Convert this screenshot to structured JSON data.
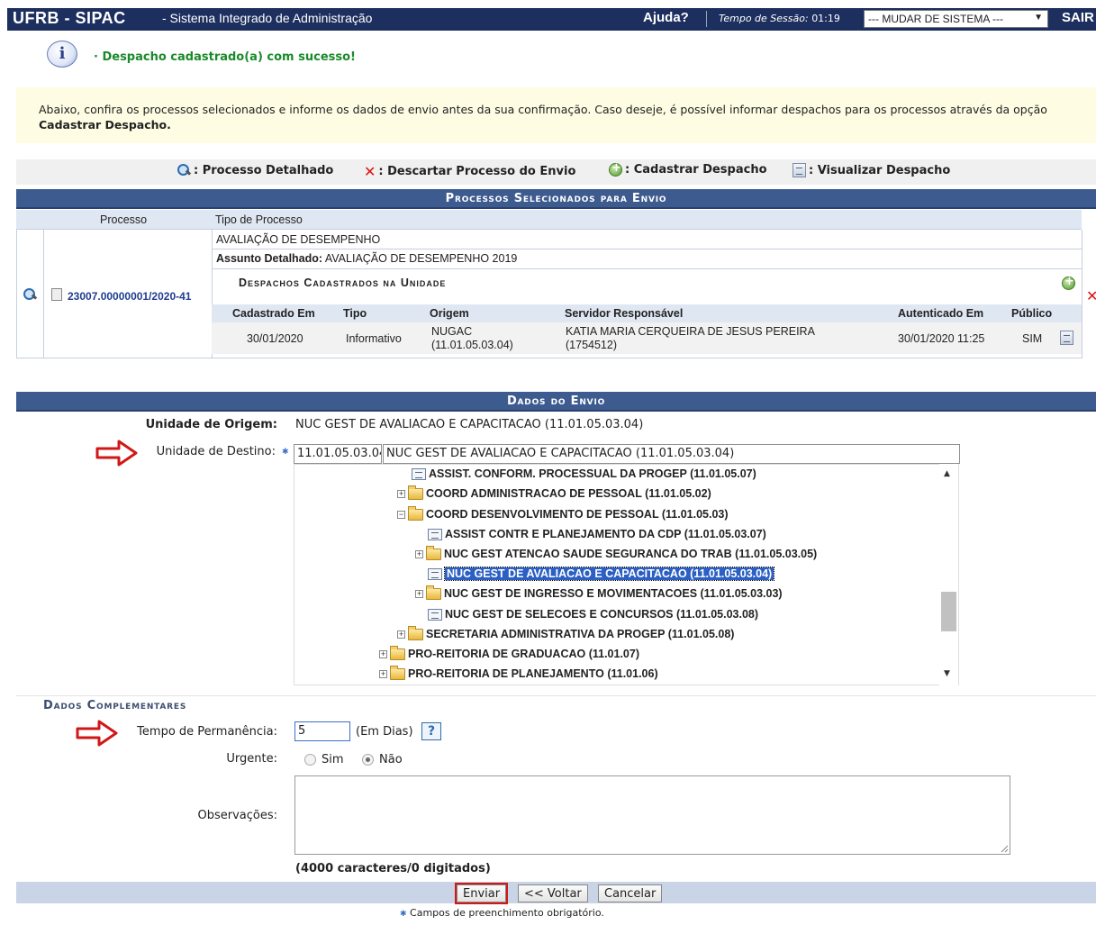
{
  "topbar": {
    "brand": "UFRB - SIPAC",
    "system_name": "- Sistema Integrado de Administração",
    "help": "Ajuda?",
    "session_label": "Tempo de Sessão:",
    "session_time": "01:19",
    "system_select": "--- MUDAR DE SISTEMA ---",
    "logout": "SAIR"
  },
  "message": {
    "text": "· Despacho cadastrado(a) com sucesso!"
  },
  "instructions": {
    "text": "Abaixo, confira os processos selecionados e informe os dados de envio antes da sua confirmação. Caso deseje, é possível informar despachos para os processos através da opção ",
    "bold": "Cadastrar Despacho."
  },
  "legend": {
    "detail": ": Processo Detalhado",
    "discard": ": Descartar Processo do Envio",
    "register": ": Cadastrar Despacho",
    "view": ": Visualizar Despacho"
  },
  "processes": {
    "title": "Processos Selecionados para Envio",
    "col_process": "Processo",
    "col_type": "Tipo de Processo",
    "process_number": "23007.00000001/2020-41",
    "process_type": "AVALIAÇÃO DE DESEMPENHO",
    "subject_label": "Assunto Detalhado:",
    "subject_value": "AVALIAÇÃO DE DESEMPENHO 2019",
    "dispatch_title": "Despachos Cadastrados na Unidade",
    "dispatch_cols": {
      "registered": "Cadastrado Em",
      "type": "Tipo",
      "origin": "Origem",
      "server": "Servidor Responsável",
      "authenticated": "Autenticado Em",
      "public": "Público"
    },
    "dispatch": {
      "registered": "30/01/2020",
      "type": "Informativo",
      "origin_line1": "NUGAC",
      "origin_line2": "(11.01.05.03.04)",
      "server_line1": "KATIA MARIA CERQUEIRA DE JESUS PEREIRA",
      "server_line2": "(1754512)",
      "authenticated": "30/01/2020 11:25",
      "public": "SIM"
    }
  },
  "shipping": {
    "title": "Dados do Envio",
    "origin_label": "Unidade de Origem:",
    "origin_value": "NUC GEST DE AVALIACAO E CAPACITACAO (11.01.05.03.04)",
    "dest_label": "Unidade de Destino:",
    "dest_code": "11.01.05.03.04",
    "dest_name": "NUC GEST DE AVALIACAO E CAPACITACAO (11.01.05.03.04)",
    "tree": [
      "ASSIST. CONFORM. PROCESSUAL DA PROGEP (11.01.05.07)",
      "COORD ADMINISTRACAO DE PESSOAL (11.01.05.02)",
      "COORD DESENVOLVIMENTO DE PESSOAL (11.01.05.03)",
      "ASSIST CONTR E PLANEJAMENTO DA CDP (11.01.05.03.07)",
      "NUC GEST ATENCAO SAUDE SEGURANCA DO TRAB (11.01.05.03.05)",
      "NUC GEST DE AVALIACAO E CAPACITACAO (11.01.05.03.04)",
      "NUC GEST DE INGRESSO E MOVIMENTACOES (11.01.05.03.03)",
      "NUC GEST DE SELECOES E CONCURSOS (11.01.05.03.08)",
      "SECRETARIA ADMINISTRATIVA DA PROGEP (11.01.05.08)",
      "PRO-REITORIA DE GRADUACAO (11.01.07)",
      "PRO-REITORIA DE PLANEJAMENTO (11.01.06)"
    ]
  },
  "complement": {
    "title": "Dados Complementares",
    "time_label": "Tempo de Permanência:",
    "time_value": "5",
    "time_unit": "(Em Dias)",
    "help_icon": "?",
    "urgent_label": "Urgente:",
    "urgent_yes": "Sim",
    "urgent_no": "Não",
    "obs_label": "Observações:",
    "counter": "(4000 caracteres/0 digitados)"
  },
  "buttons": {
    "send": "Enviar",
    "back": "<< Voltar",
    "cancel": "Cancelar"
  },
  "required_note": "Campos de preenchimento obrigatório."
}
